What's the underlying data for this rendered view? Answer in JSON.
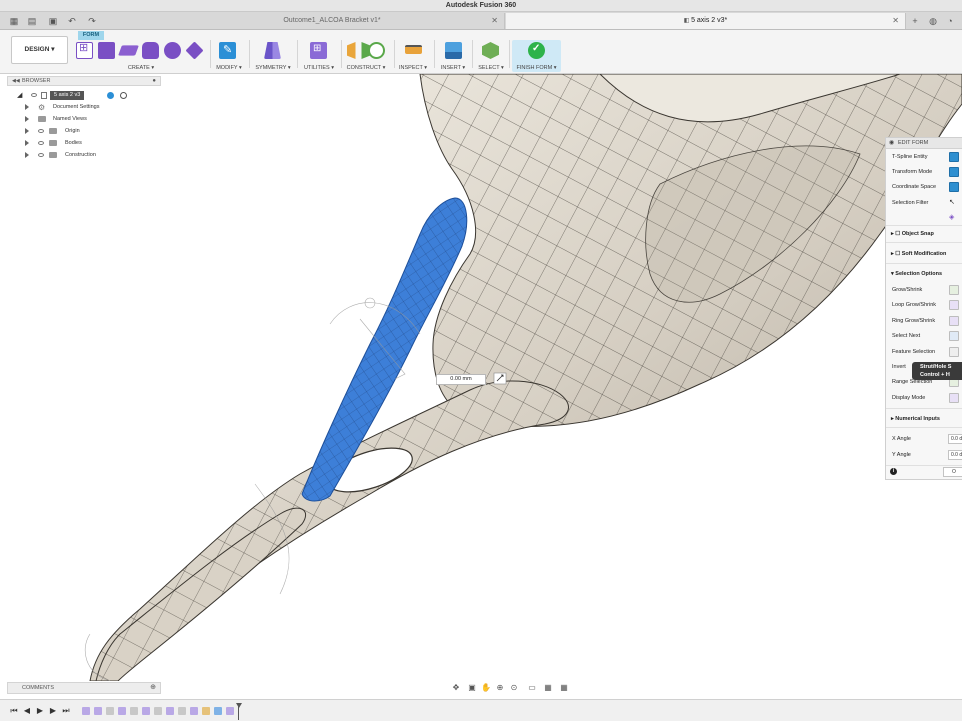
{
  "window": {
    "title": "Autodesk Fusion 360"
  },
  "tabs": [
    {
      "label": "Outcome1_ALCOA Bracket v1*",
      "active": false
    },
    {
      "label": "5 axis 2 v3*",
      "active": true
    }
  ],
  "ribbon": {
    "workspace_label": "DESIGN ▾",
    "active_tab": "FORM",
    "groups": [
      "CREATE ▾",
      "MODIFY ▾",
      "SYMMETRY ▾",
      "UTILITIES ▾",
      "CONSTRUCT ▾",
      "INSPECT ▾",
      "INSERT ▾",
      "SELECT ▾",
      "FINISH FORM ▾"
    ],
    "colors": {
      "create": "#7a4fc4",
      "modify": "#2b8fd6",
      "finish": "#2db34a",
      "highlight": "#cfe9f6"
    }
  },
  "browser": {
    "title": "BROWSER",
    "root": "5 axis 2 v3",
    "items": [
      "Document Settings",
      "Named Views",
      "Origin",
      "Bodies",
      "Construction"
    ]
  },
  "viewport": {
    "dimension_value": "0.00 mm",
    "colors": {
      "body": "#dcd6cc",
      "selection": "#3d7fd8",
      "mesh": "#2a2a2a"
    }
  },
  "edit_form": {
    "title": "EDIT FORM",
    "rows": [
      "T-Spline Entity",
      "Transform Mode",
      "Coordinate Space",
      "Selection Filter"
    ],
    "sections": [
      "Object Snap",
      "Soft Modification",
      "Selection Options"
    ],
    "selection_options": [
      "Grow/Shrink",
      "Loop Grow/Shrink",
      "Ring Grow/Shrink",
      "Select Next",
      "Feature Selection",
      "Invert",
      "Range Selection",
      "Display Mode"
    ],
    "numerical_inputs": "Numerical Inputs",
    "x_angle_label": "X Angle",
    "x_angle_value": "0.0 d",
    "y_angle_label": "Y Angle",
    "y_angle_value": "0.0 d",
    "ok_label": "O"
  },
  "tooltip": {
    "line1": "Strut/Hole S",
    "line2": "Control + H"
  },
  "comments": {
    "title": "COMMENTS"
  }
}
